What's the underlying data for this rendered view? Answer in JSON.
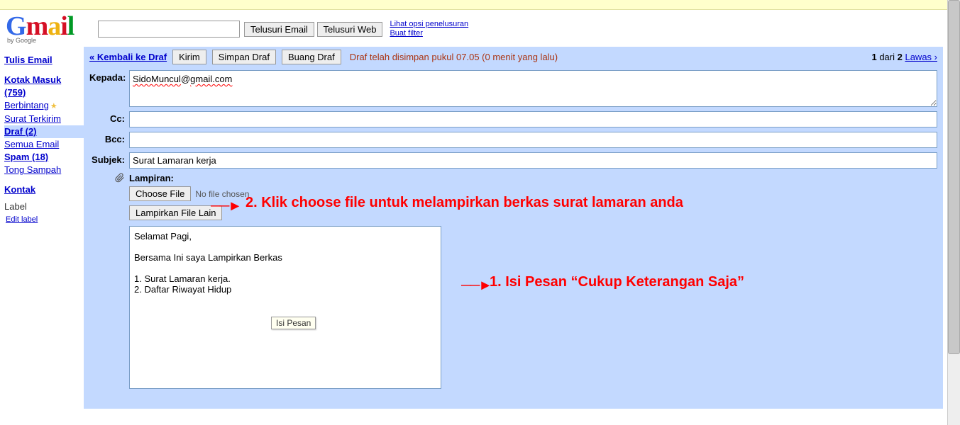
{
  "header": {
    "search_button1": "Telusuri Email",
    "search_button2": "Telusuri Web",
    "search_link1": "Lihat opsi penelusuran",
    "search_link2": "Buat filter",
    "by_google": "by Google"
  },
  "sidebar": {
    "compose": "Tulis Email",
    "inbox": "Kotak Masuk (759)",
    "starred": "Berbintang",
    "sent": "Surat Terkirim",
    "drafts": "Draf (2)",
    "allmail": "Semua Email",
    "spam": "Spam (18)",
    "trash": "Tong Sampah",
    "contacts": "Kontak",
    "labels_head": "Label",
    "edit_label": "Edit label"
  },
  "toolbar": {
    "back": "« Kembali ke Draf",
    "send": "Kirim",
    "save": "Simpan Draf",
    "discard": "Buang Draf",
    "status": "Draf telah disimpan pukul 07.05 (0 menit yang lalu)",
    "pager_prefix": "1",
    "pager_mid": " dari ",
    "pager_total": "2",
    "pager_older": "Lawas ›"
  },
  "compose": {
    "to_label": "Kepada:",
    "to_value_part1": "SidoMuncul",
    "to_value_part2": "@",
    "to_value_part3": "gmail.com",
    "cc_label": "Cc:",
    "bcc_label": "Bcc:",
    "subject_label": "Subjek:",
    "subject_value": "Surat Lamaran kerja",
    "attach_heading": "Lampiran:",
    "choose_file": "Choose File",
    "no_file": "No file chosen",
    "attach_more": "Lampirkan File Lain",
    "body_text": "Selamat Pagi,\n\nBersama Ini saya Lampirkan Berkas\n\n1. Surat Lamaran kerja.\n2. Daftar Riwayat Hidup",
    "isi_pesan_tooltip": "Isi Pesan"
  },
  "annotations": {
    "anno2": "2. Klik choose file untuk melampirkan berkas surat lamaran anda",
    "anno1": "1. Isi Pesan “Cukup Keterangan Saja”"
  }
}
